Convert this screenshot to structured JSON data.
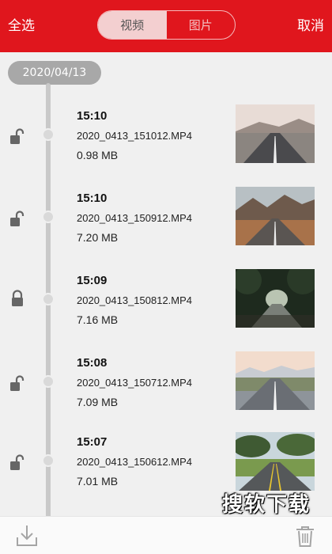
{
  "header": {
    "select_all": "全选",
    "cancel": "取消",
    "tabs": [
      {
        "label": "视频",
        "active": true
      },
      {
        "label": "图片",
        "active": false
      }
    ],
    "brand_color": "#e0161d"
  },
  "date_group": "2020/04/13",
  "items": [
    {
      "time": "15:10",
      "filename": "2020_0413_151012.MP4",
      "size": "0.98 MB",
      "locked": false,
      "thumb": "road-desert-icon"
    },
    {
      "time": "15:10",
      "filename": "2020_0413_150912.MP4",
      "size": "7.20 MB",
      "locked": false,
      "thumb": "road-mountains-icon"
    },
    {
      "time": "15:09",
      "filename": "2020_0413_150812.MP4",
      "size": "7.16 MB",
      "locked": true,
      "thumb": "road-forest-dark-icon"
    },
    {
      "time": "15:08",
      "filename": "2020_0413_150712.MP4",
      "size": "7.09 MB",
      "locked": false,
      "thumb": "road-snow-mountains-icon"
    },
    {
      "time": "15:07",
      "filename": "2020_0413_150612.MP4",
      "size": "7.01 MB",
      "locked": false,
      "thumb": "road-trees-icon"
    }
  ],
  "watermark": "搜软下载"
}
